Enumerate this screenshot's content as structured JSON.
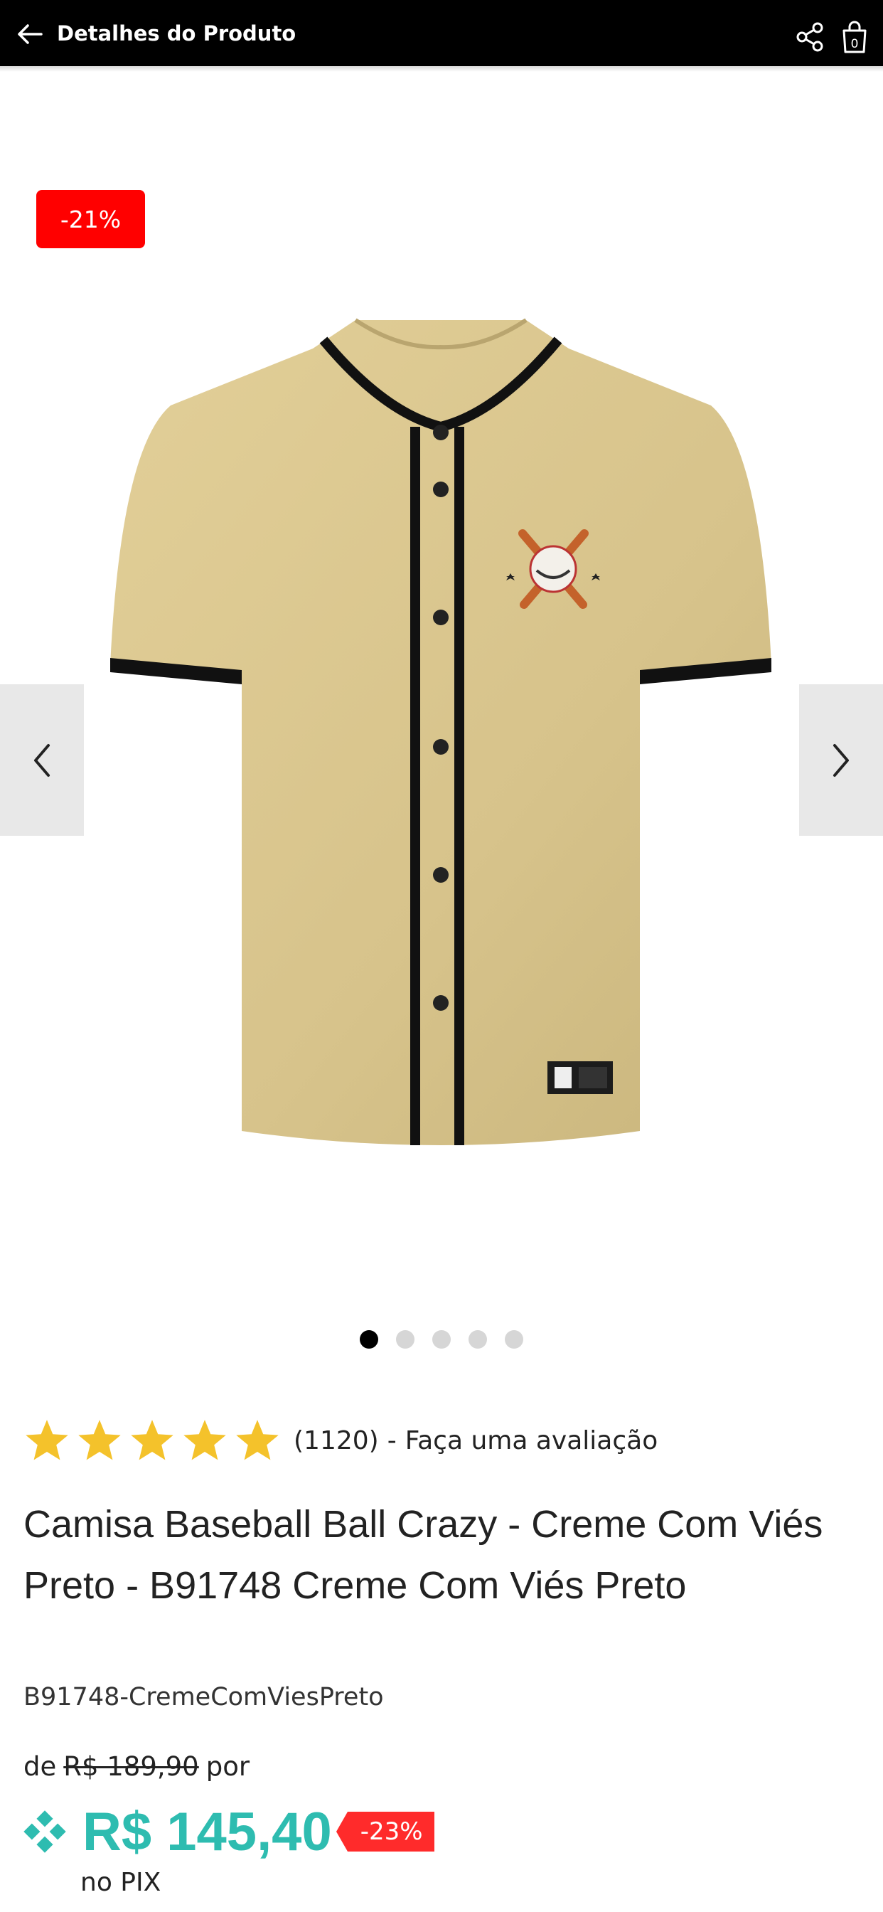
{
  "header": {
    "title": "Detalhes do Produto",
    "back_icon": "arrow-left-icon",
    "share_icon": "share-icon",
    "bag_icon": "shopping-bag-icon",
    "bag_count": "0"
  },
  "gallery": {
    "discount_badge": "-21%",
    "image_alt": "Camisa baseball creme com viés preto",
    "dots_total": 5,
    "active_dot": 1
  },
  "rating": {
    "stars": 5,
    "count": "(1120)",
    "separator": "-",
    "link": "Faça uma avaliação"
  },
  "product": {
    "title": "Camisa Baseball Ball Crazy - Creme Com Viés Preto - B91748 Creme Com Viés Preto",
    "sku": "B91748-CremeComViesPreto"
  },
  "pricing": {
    "prefix": "de",
    "old_price": "R$ 189,90",
    "suffix": "por",
    "pix_price": "R$ 145,40",
    "pix_discount": "-23%",
    "pix_note": "no PIX"
  },
  "colors": {
    "header_bg": "#000000",
    "badge_red": "#ff0000",
    "pix_teal": "#2ebcb0",
    "star_gold": "#f4c22b",
    "shirt_cream": "#d9c58e"
  }
}
